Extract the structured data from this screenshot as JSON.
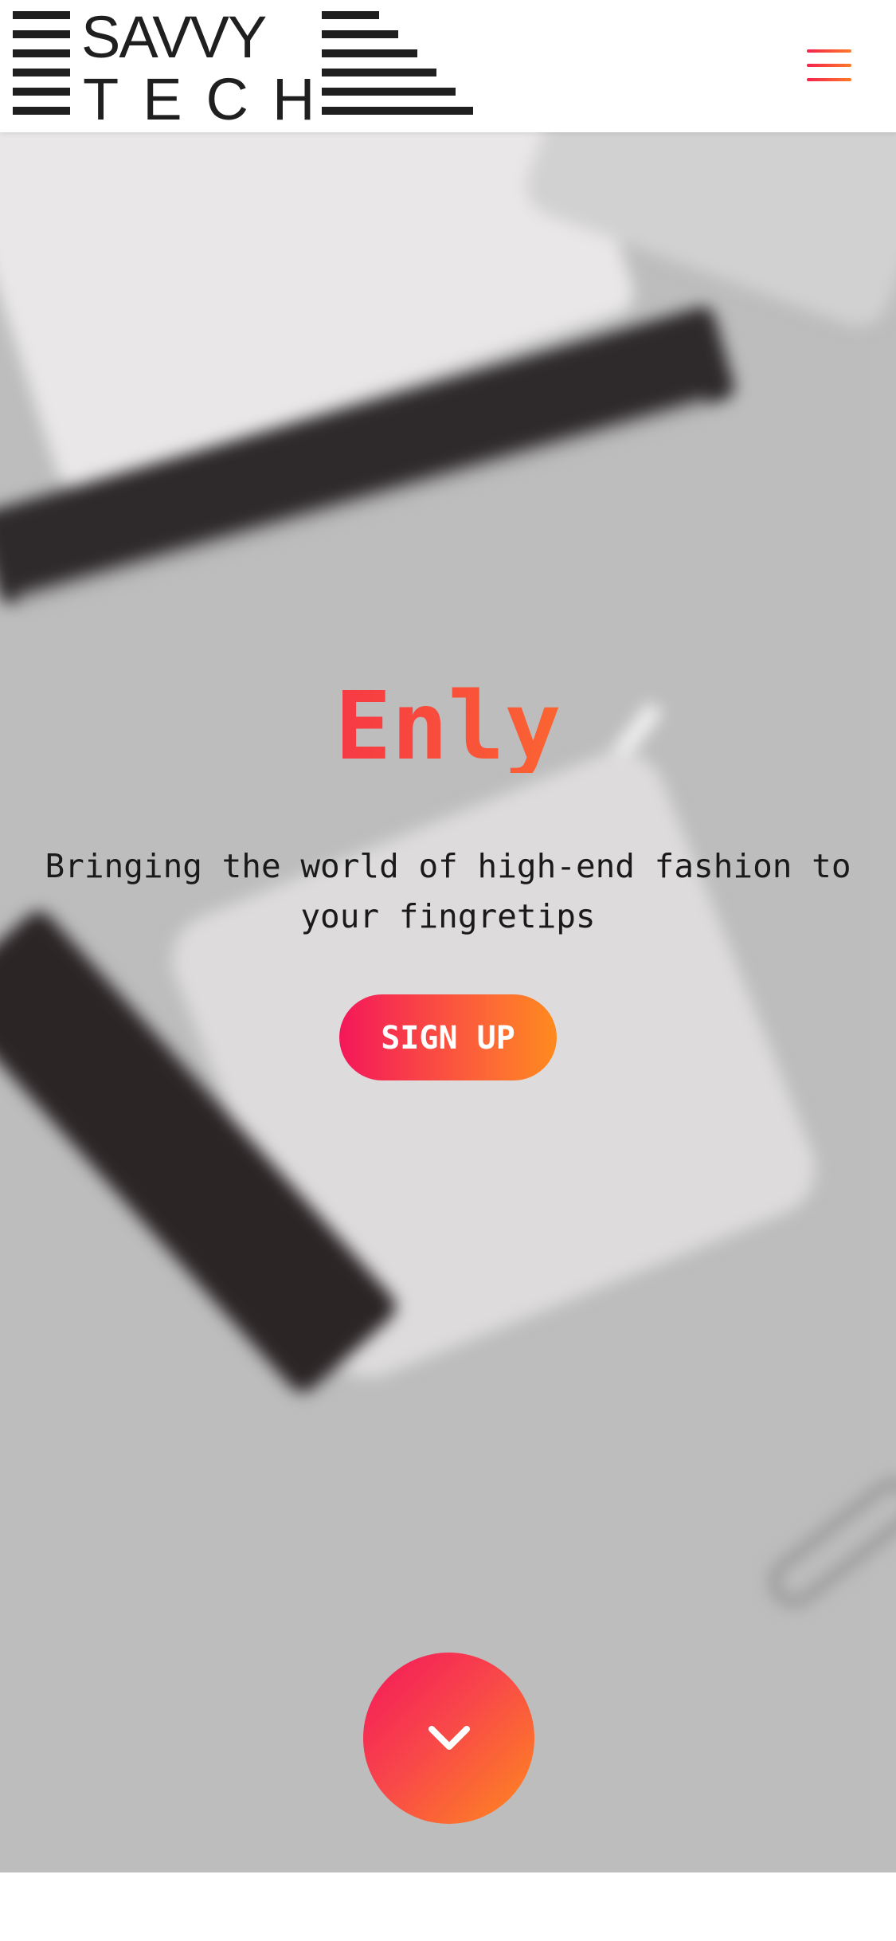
{
  "header": {
    "logo": {
      "line1": "SAVVY",
      "line2": "TECH"
    },
    "menu_icon": "hamburger-menu-icon"
  },
  "hero": {
    "title": "Enly",
    "tagline": "Bringing the world of high-end fashion to your fingretips",
    "signup_label": "SIGN UP",
    "scroll_icon": "chevron-down-icon"
  },
  "colors": {
    "accent_start": "#f4224e",
    "accent_end": "#fd7b28",
    "hero_background": "#bdbdbd"
  }
}
